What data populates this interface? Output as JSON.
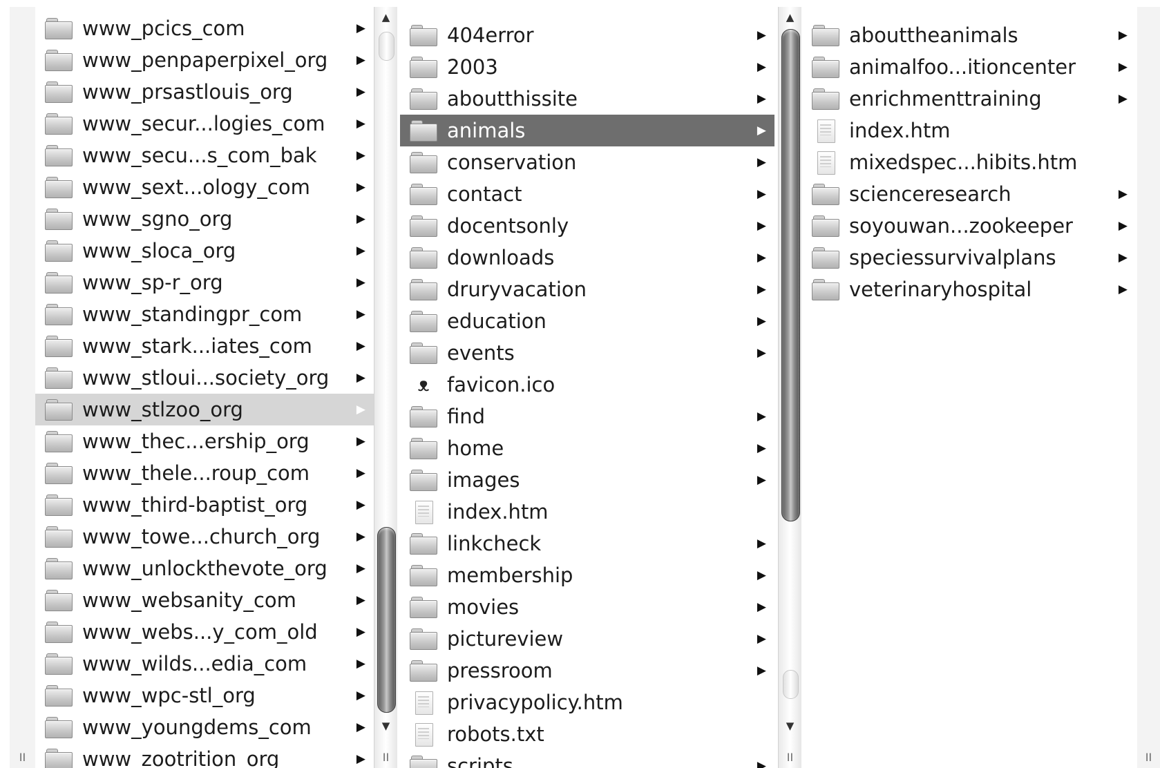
{
  "columns": [
    {
      "id": "sites",
      "items": [
        {
          "name": "www_pcics_com",
          "type": "folder"
        },
        {
          "name": "www_penpaperpixel_org",
          "type": "folder"
        },
        {
          "name": "www_prsastlouis_org",
          "type": "folder"
        },
        {
          "name": "www_secur...logies_com",
          "type": "folder"
        },
        {
          "name": "www_secu...s_com_bak",
          "type": "folder"
        },
        {
          "name": "www_sext...ology_com",
          "type": "folder"
        },
        {
          "name": "www_sgno_org",
          "type": "folder"
        },
        {
          "name": "www_sloca_org",
          "type": "folder"
        },
        {
          "name": "www_sp-r_org",
          "type": "folder"
        },
        {
          "name": "www_standingpr_com",
          "type": "folder"
        },
        {
          "name": "www_stark...iates_com",
          "type": "folder"
        },
        {
          "name": "www_stloui...society_org",
          "type": "folder"
        },
        {
          "name": "www_stlzoo_org",
          "type": "folder",
          "state": "parent"
        },
        {
          "name": "www_thec...ership_org",
          "type": "folder"
        },
        {
          "name": "www_thele...roup_com",
          "type": "folder"
        },
        {
          "name": "www_third-baptist_org",
          "type": "folder"
        },
        {
          "name": "www_towe...church_org",
          "type": "folder"
        },
        {
          "name": "www_unlockthevote_org",
          "type": "folder"
        },
        {
          "name": "www_websanity_com",
          "type": "folder"
        },
        {
          "name": "www_webs...y_com_old",
          "type": "folder"
        },
        {
          "name": "www_wilds...edia_com",
          "type": "folder"
        },
        {
          "name": "www_wpc-stl_org",
          "type": "folder"
        },
        {
          "name": "www_youngdems_com",
          "type": "folder"
        },
        {
          "name": "www_zootrition_org",
          "type": "folder"
        }
      ]
    },
    {
      "id": "stlzoo",
      "items": [
        {
          "name": "404error",
          "type": "folder"
        },
        {
          "name": "2003",
          "type": "folder"
        },
        {
          "name": "aboutthissite",
          "type": "folder"
        },
        {
          "name": "animals",
          "type": "folder",
          "state": "selected"
        },
        {
          "name": "conservation",
          "type": "folder"
        },
        {
          "name": "contact",
          "type": "folder"
        },
        {
          "name": "docentsonly",
          "type": "folder"
        },
        {
          "name": "downloads",
          "type": "folder"
        },
        {
          "name": "druryvacation",
          "type": "folder"
        },
        {
          "name": "education",
          "type": "folder"
        },
        {
          "name": "events",
          "type": "folder"
        },
        {
          "name": "favicon.ico",
          "type": "favicon"
        },
        {
          "name": "find",
          "type": "folder"
        },
        {
          "name": "home",
          "type": "folder"
        },
        {
          "name": "images",
          "type": "folder"
        },
        {
          "name": "index.htm",
          "type": "file"
        },
        {
          "name": "linkcheck",
          "type": "folder"
        },
        {
          "name": "membership",
          "type": "folder"
        },
        {
          "name": "movies",
          "type": "folder"
        },
        {
          "name": "pictureview",
          "type": "folder"
        },
        {
          "name": "pressroom",
          "type": "folder"
        },
        {
          "name": "privacypolicy.htm",
          "type": "file"
        },
        {
          "name": "robots.txt",
          "type": "file"
        },
        {
          "name": "scripts",
          "type": "folder"
        }
      ]
    },
    {
      "id": "animals",
      "items": [
        {
          "name": "abouttheanimals",
          "type": "folder"
        },
        {
          "name": "animalfoo...itioncenter",
          "type": "folder"
        },
        {
          "name": "enrichmenttraining",
          "type": "folder"
        },
        {
          "name": "index.htm",
          "type": "file"
        },
        {
          "name": "mixedspec...hibits.htm",
          "type": "file"
        },
        {
          "name": "scienceresearch",
          "type": "folder"
        },
        {
          "name": "soyouwan...zookeeper",
          "type": "folder"
        },
        {
          "name": "speciessurvivalplans",
          "type": "folder"
        },
        {
          "name": "veterinaryhospital",
          "type": "folder"
        }
      ]
    }
  ],
  "glyphs": {
    "disclosure_arrow": "▶",
    "scroll_up": "▲",
    "scroll_down": "▼",
    "column_grip": "II",
    "favicon_glyph": "ᴥ"
  },
  "scrollbars": [
    {
      "column": "sites",
      "scroll_fraction": 1.0,
      "visible_fraction": 0.27
    },
    {
      "column": "stlzoo",
      "scroll_fraction": 0.0,
      "visible_fraction": 0.72
    }
  ],
  "icons": {
    "folder": "folder-icon",
    "file": "document-icon",
    "favicon": "zoo-logo-icon",
    "disclosure": "chevron-right-icon"
  },
  "colors": {
    "selected_row": "#6e6e6e",
    "parent_row": "#d6d6d6",
    "text": "#1c1c1c",
    "selected_text": "#ffffff"
  }
}
